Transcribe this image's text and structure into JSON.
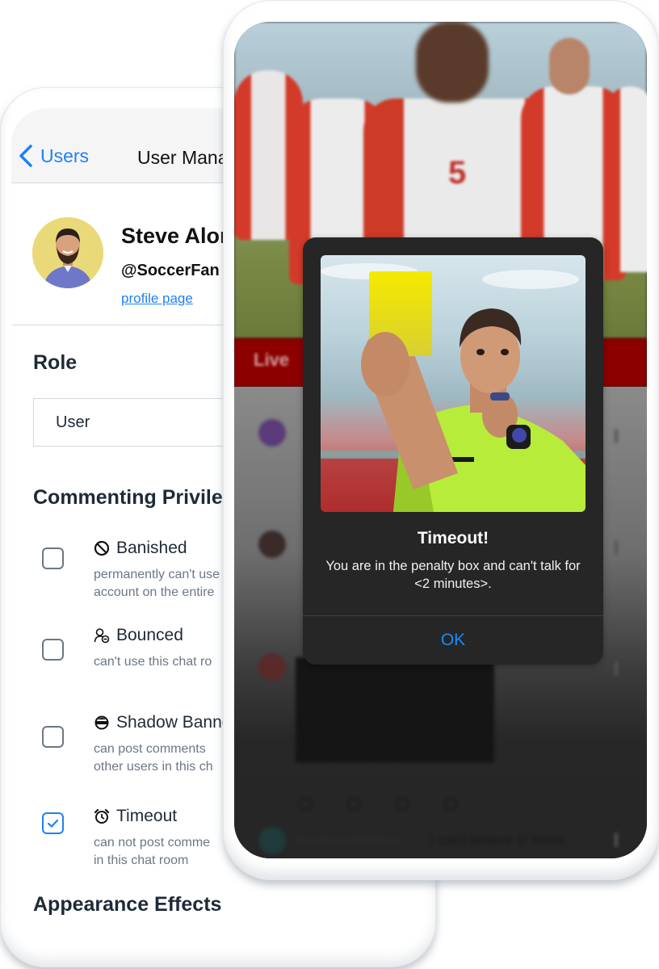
{
  "left_phone": {
    "nav": {
      "back_label": "Users",
      "title": "User Management"
    },
    "profile": {
      "name": "Steve Alonso",
      "handle": "@SoccerFan",
      "link_label": "profile page",
      "avatar_bg": "#ead978"
    },
    "role": {
      "heading": "Role",
      "selected": "User"
    },
    "commenting": {
      "heading": "Commenting Privileges",
      "items": [
        {
          "icon": "prohibited-icon",
          "label": "Banished",
          "desc": "permanently can't use\naccount on the entire",
          "checked": false
        },
        {
          "icon": "user-minus-icon",
          "label": "Bounced",
          "desc": "can't use this chat ro",
          "checked": false
        },
        {
          "icon": "incognito-icon",
          "label": "Shadow Banned",
          "desc": "can post comments\nother users in this ch",
          "checked": false
        },
        {
          "icon": "alarm-clock-icon",
          "label": "Timeout",
          "desc": "can not post comme\nin this chat room",
          "checked": true
        }
      ]
    },
    "appearance": {
      "heading": "Appearance Effects"
    }
  },
  "right_phone": {
    "live_bar_label": "Live",
    "feed": {
      "comment_text": "I can't believe it! Nooo",
      "username": "GoalkeeperMikey"
    },
    "alert": {
      "title": "Timeout!",
      "message": "You are in the penalty box and can't talk for <2 minutes>.",
      "ok_label": "OK",
      "ok_color": "#1d8bf5"
    }
  },
  "colors": {
    "accent_blue": "#1d82f5",
    "live_red": "#8c0000",
    "alert_bg": "#262626"
  }
}
